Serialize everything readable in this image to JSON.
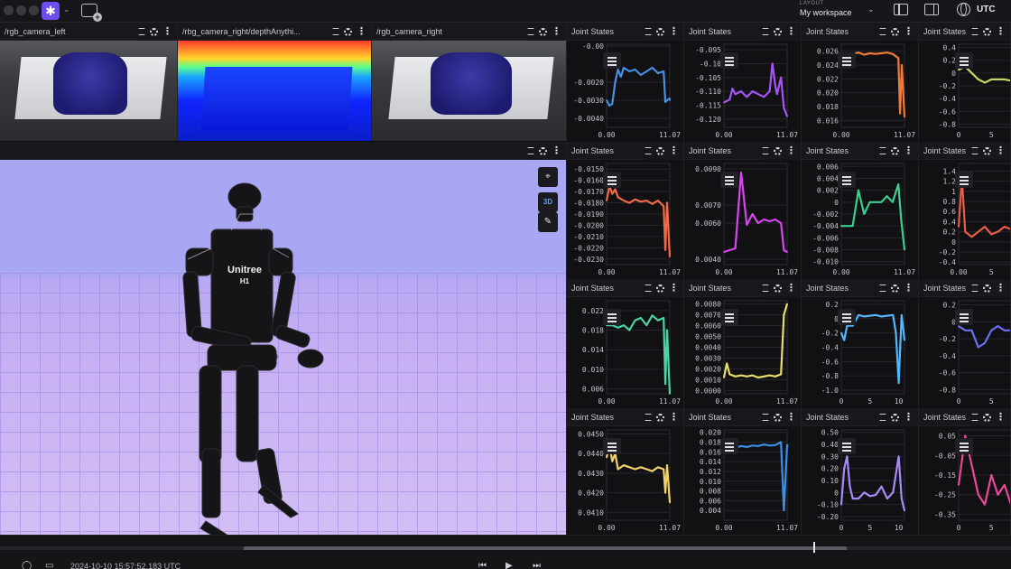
{
  "topbar": {
    "menu_caret": "⌄",
    "layout_caption": "LAYOUT",
    "layout_name": "My workspace",
    "layout_caret": "⌄",
    "timezone": "UTC"
  },
  "panels": {
    "cam_left": {
      "title": "/rgb_camera_left"
    },
    "cam_depth": {
      "title": "/rbg_camera_right/depthAnythi..."
    },
    "cam_right": {
      "title": "/rgb_camera_right"
    },
    "robot": {
      "logo_line1": "Unitree",
      "logo_line2": "H1"
    }
  },
  "viewport_tools": {
    "select": "⌖",
    "mode": "3D",
    "measure": "✎"
  },
  "chart_title": "Joint States",
  "colors": {
    "blue": "#4a90e2",
    "violet": "#a855f7",
    "orange": "#f07b3f",
    "olive": "#c9d36a",
    "coral": "#ef6b45",
    "magenta": "#d946ef",
    "green": "#3ecf8e",
    "red": "#e85d4a",
    "mint": "#4fd1a5",
    "yellow": "#e6e06a",
    "sky": "#56b6f7",
    "indigo": "#6d6df0",
    "gold": "#f2d16b",
    "azure": "#3b8fe8",
    "lavender": "#a78bfa",
    "pink": "#ec4899"
  },
  "chart_data": [
    {
      "type": "line",
      "title": "Joint States",
      "ylim": [
        -0.0045,
        0.0001
      ],
      "yticks": [
        "-0.00",
        "-0.0020",
        "-0.0030",
        "-0.0040"
      ],
      "xticks": [
        "0.00",
        "11.07"
      ],
      "color": "blue",
      "series": [
        {
          "x": [
            0,
            0.5,
            1,
            1.5,
            2,
            2.5,
            3,
            4,
            5,
            6,
            7,
            8,
            9,
            10,
            10.3,
            10.6,
            11,
            11.07
          ],
          "values": [
            -0.003,
            -0.0033,
            -0.0032,
            -0.002,
            -0.0013,
            -0.0017,
            -0.0012,
            -0.0014,
            -0.0013,
            -0.0016,
            -0.0014,
            -0.0012,
            -0.0015,
            -0.0014,
            -0.0031,
            -0.003,
            -0.0029,
            -0.003
          ]
        }
      ]
    },
    {
      "type": "line",
      "title": "Joint States",
      "ylim": [
        -0.123,
        -0.093
      ],
      "yticks": [
        "-0.095",
        "-0.10",
        "-0.105",
        "-0.110",
        "-0.115",
        "-0.120"
      ],
      "xticks": [
        "0.00",
        "11.07"
      ],
      "color": "violet",
      "series": [
        {
          "x": [
            0,
            1,
            1.5,
            2,
            3,
            4,
            5,
            6,
            7,
            8,
            8.5,
            9,
            9.3,
            10,
            10.5,
            11.07
          ],
          "values": [
            -0.114,
            -0.113,
            -0.109,
            -0.111,
            -0.11,
            -0.112,
            -0.11,
            -0.111,
            -0.112,
            -0.11,
            -0.1,
            -0.108,
            -0.111,
            -0.105,
            -0.116,
            -0.119
          ]
        }
      ]
    },
    {
      "type": "line",
      "title": "Joint States",
      "ylim": [
        0.015,
        0.027
      ],
      "yticks": [
        "0.026",
        "0.024",
        "0.022",
        "0.020",
        "0.018",
        "0.016"
      ],
      "xticks": [
        "0.00",
        "11.07"
      ],
      "color": "orange",
      "series": [
        {
          "x": [
            0,
            0.5,
            1,
            1.5,
            2,
            3,
            4,
            5,
            6,
            7,
            8,
            9,
            10,
            10.3,
            10.6,
            11.07
          ],
          "values": [
            0.0245,
            0.025,
            0.0243,
            0.0255,
            0.0256,
            0.0258,
            0.0255,
            0.0257,
            0.0256,
            0.0257,
            0.0258,
            0.0256,
            0.025,
            0.017,
            0.024,
            0.0165
          ]
        }
      ]
    },
    {
      "type": "line",
      "title": "Joint States",
      "ylim": [
        -0.85,
        0.45
      ],
      "yticks": [
        "0.4",
        "0.2",
        "0",
        "-0.2",
        "-0.4",
        "-0.6",
        "-0.8"
      ],
      "xticks": [
        "0",
        "5"
      ],
      "color": "olive",
      "series": [
        {
          "x": [
            0,
            1,
            2,
            3,
            4,
            5,
            6,
            7,
            8
          ],
          "values": [
            0.05,
            0.1,
            0.0,
            -0.1,
            -0.15,
            -0.1,
            -0.1,
            -0.1,
            -0.12
          ]
        }
      ]
    },
    {
      "type": "line",
      "title": "Joint States",
      "ylim": [
        -0.0235,
        -0.0145
      ],
      "yticks": [
        "-0.0150",
        "-0.0160",
        "-0.0170",
        "-0.0180",
        "-0.0190",
        "-0.0200",
        "-0.0210",
        "-0.0220",
        "-0.0230"
      ],
      "xticks": [
        "0.00",
        "11.07"
      ],
      "color": "coral",
      "series": [
        {
          "x": [
            0,
            0.5,
            1,
            1.5,
            2,
            3,
            4,
            5,
            6,
            7,
            8,
            9,
            10,
            10.3,
            10.6,
            11.07
          ],
          "values": [
            -0.0178,
            -0.0165,
            -0.0172,
            -0.0168,
            -0.0175,
            -0.0178,
            -0.018,
            -0.0177,
            -0.0179,
            -0.0178,
            -0.0181,
            -0.0178,
            -0.0183,
            -0.0222,
            -0.018,
            -0.0228
          ]
        }
      ]
    },
    {
      "type": "line",
      "title": "Joint States",
      "ylim": [
        0.0037,
        0.0093
      ],
      "yticks": [
        "0.0090",
        "0.0070",
        "0.0060",
        "0.0040"
      ],
      "xticks": [
        "0.00",
        "11.07"
      ],
      "color": "magenta",
      "series": [
        {
          "x": [
            0,
            1,
            2,
            3,
            4,
            5,
            6,
            7,
            8,
            9,
            10,
            10.5,
            11.07
          ],
          "values": [
            0.0044,
            0.0045,
            0.0046,
            0.0088,
            0.0059,
            0.0065,
            0.006,
            0.0062,
            0.0061,
            0.0062,
            0.006,
            0.0045,
            0.0044
          ]
        }
      ]
    },
    {
      "type": "line",
      "title": "Joint States",
      "ylim": [
        -0.0105,
        0.0065
      ],
      "yticks": [
        "0.006",
        "0.004",
        "0.002",
        "0",
        "-0.002",
        "-0.004",
        "-0.006",
        "-0.008",
        "-0.010"
      ],
      "xticks": [
        "0.00",
        "11.07"
      ],
      "color": "green",
      "series": [
        {
          "x": [
            0,
            1,
            2,
            3,
            4,
            5,
            6,
            7,
            8,
            9,
            10,
            10.5,
            11.07
          ],
          "values": [
            -0.004,
            -0.004,
            -0.004,
            0.002,
            -0.002,
            0.0,
            0.0,
            0.0,
            0.001,
            0.0,
            0.003,
            -0.003,
            -0.008
          ]
        }
      ]
    },
    {
      "type": "line",
      "title": "Joint States",
      "ylim": [
        -0.45,
        1.55
      ],
      "yticks": [
        "1.4",
        "1.2",
        "1",
        "0.8",
        "0.6",
        "0.4",
        "0.2",
        "0",
        "-0.2",
        "-0.4"
      ],
      "xticks": [
        "0.00",
        "5"
      ],
      "color": "red",
      "series": [
        {
          "x": [
            0,
            0.5,
            1,
            2,
            3,
            4,
            5,
            6,
            7,
            8
          ],
          "values": [
            0.3,
            1.25,
            0.2,
            0.1,
            0.2,
            0.3,
            0.15,
            0.2,
            0.3,
            0.25
          ]
        }
      ]
    },
    {
      "type": "line",
      "title": "Joint States",
      "ylim": [
        0.005,
        0.024
      ],
      "yticks": [
        "0.022",
        "0.018",
        "0.014",
        "0.010",
        "0.006"
      ],
      "xticks": [
        "0.00",
        "11.07"
      ],
      "color": "mint",
      "series": [
        {
          "x": [
            0,
            1,
            2,
            3,
            4,
            5,
            6,
            7,
            8,
            9,
            10,
            10.3,
            10.6,
            11.07
          ],
          "values": [
            0.019,
            0.019,
            0.0185,
            0.019,
            0.018,
            0.02,
            0.0205,
            0.019,
            0.021,
            0.02,
            0.0205,
            0.007,
            0.018,
            0.005
          ]
        }
      ]
    },
    {
      "type": "line",
      "title": "Joint States",
      "ylim": [
        -0.0003,
        0.0083
      ],
      "yticks": [
        "0.0080",
        "0.0070",
        "0.0060",
        "0.0050",
        "0.0040",
        "0.0030",
        "0.0020",
        "0.0010",
        "0.0000"
      ],
      "xticks": [
        "0.00",
        "11.07"
      ],
      "color": "yellow",
      "series": [
        {
          "x": [
            0,
            0.5,
            1,
            2,
            3,
            4,
            5,
            6,
            7,
            8,
            9,
            10,
            10.5,
            11.07
          ],
          "values": [
            0.0012,
            0.0025,
            0.0015,
            0.0013,
            0.0014,
            0.0013,
            0.0014,
            0.0012,
            0.0013,
            0.0014,
            0.0013,
            0.0015,
            0.007,
            0.008
          ]
        }
      ]
    },
    {
      "type": "line",
      "title": "Joint States",
      "ylim": [
        -1.05,
        0.25
      ],
      "yticks": [
        "0.2",
        "0",
        "-0.2",
        "-0.4",
        "-0.6",
        "-0.8",
        "-1.0"
      ],
      "xticks": [
        "0",
        "5",
        "10"
      ],
      "color": "sky",
      "series": [
        {
          "x": [
            0,
            0.5,
            1,
            2,
            3,
            4,
            5,
            6,
            7,
            8,
            9,
            9.5,
            10,
            10.5,
            11
          ],
          "values": [
            -0.2,
            -0.3,
            -0.1,
            -0.1,
            0.05,
            0.03,
            0.04,
            0.05,
            0.03,
            0.04,
            0.05,
            -0.2,
            -0.9,
            0.05,
            -0.3
          ]
        }
      ]
    },
    {
      "type": "line",
      "title": "Joint States",
      "ylim": [
        -0.85,
        0.25
      ],
      "yticks": [
        "0.2",
        "0",
        "-0.2",
        "-0.4",
        "-0.6",
        "-0.8"
      ],
      "xticks": [
        "0",
        "5"
      ],
      "color": "indigo",
      "series": [
        {
          "x": [
            0,
            1,
            2,
            3,
            4,
            5,
            6,
            7,
            8
          ],
          "values": [
            -0.05,
            -0.1,
            -0.1,
            -0.3,
            -0.25,
            -0.1,
            -0.05,
            -0.1,
            -0.1
          ]
        }
      ]
    },
    {
      "type": "line",
      "title": "Joint States",
      "ylim": [
        0.0406,
        0.0452
      ],
      "yticks": [
        "0.0450",
        "0.0440",
        "0.0430",
        "0.0420",
        "0.0410"
      ],
      "xticks": [
        "0.00",
        "11.07"
      ],
      "color": "gold",
      "series": [
        {
          "x": [
            0,
            0.5,
            1,
            1.5,
            2,
            3,
            4,
            5,
            6,
            7,
            8,
            9,
            10,
            10.3,
            10.6,
            11.07
          ],
          "values": [
            0.0438,
            0.0444,
            0.0436,
            0.044,
            0.0432,
            0.0434,
            0.0433,
            0.0432,
            0.0433,
            0.0432,
            0.0431,
            0.0433,
            0.0432,
            0.042,
            0.0434,
            0.0415
          ]
        }
      ]
    },
    {
      "type": "line",
      "title": "Joint States",
      "ylim": [
        0.002,
        0.0205
      ],
      "yticks": [
        "0.020",
        "0.018",
        "0.016",
        "0.014",
        "0.012",
        "0.010",
        "0.008",
        "0.006",
        "0.004"
      ],
      "xticks": [
        "0.00",
        "11.07"
      ],
      "color": "azure",
      "series": [
        {
          "x": [
            0,
            1,
            2,
            3,
            4,
            5,
            6,
            7,
            8,
            9,
            10,
            10.5,
            11.07
          ],
          "values": [
            0.016,
            0.017,
            0.0168,
            0.0172,
            0.017,
            0.0173,
            0.0172,
            0.0175,
            0.0173,
            0.0174,
            0.018,
            0.004,
            0.0175
          ]
        }
      ]
    },
    {
      "type": "line",
      "title": "Joint States",
      "ylim": [
        -0.23,
        0.52
      ],
      "yticks": [
        "0.50",
        "0.40",
        "0.30",
        "0.20",
        "0.10",
        "0",
        "-0.10",
        "-0.20"
      ],
      "xticks": [
        "0",
        "5",
        "10"
      ],
      "color": "lavender",
      "series": [
        {
          "x": [
            0,
            0.5,
            1,
            1.5,
            2,
            3,
            4,
            5,
            6,
            7,
            8,
            9,
            10,
            10.5,
            11
          ],
          "values": [
            -0.1,
            0.2,
            0.3,
            0.05,
            -0.05,
            -0.05,
            0.0,
            -0.03,
            -0.02,
            0.05,
            -0.05,
            0.0,
            0.3,
            -0.05,
            -0.15
          ]
        }
      ]
    },
    {
      "type": "line",
      "title": "Joint States",
      "ylim": [
        -0.38,
        0.08
      ],
      "yticks": [
        "0.05",
        "-0.05",
        "-0.15",
        "-0.25",
        "-0.35"
      ],
      "xticks": [
        "0",
        "5"
      ],
      "color": "pink",
      "series": [
        {
          "x": [
            0,
            1,
            2,
            3,
            4,
            5,
            6,
            7,
            8
          ],
          "values": [
            -0.2,
            0.05,
            -0.1,
            -0.25,
            -0.3,
            -0.15,
            -0.25,
            -0.2,
            -0.3
          ]
        }
      ]
    }
  ],
  "timeline": {
    "time_label": "2024-10-10 15:57:52.183 UTC",
    "controls": [
      "⏮",
      "▶",
      "⏭"
    ]
  }
}
